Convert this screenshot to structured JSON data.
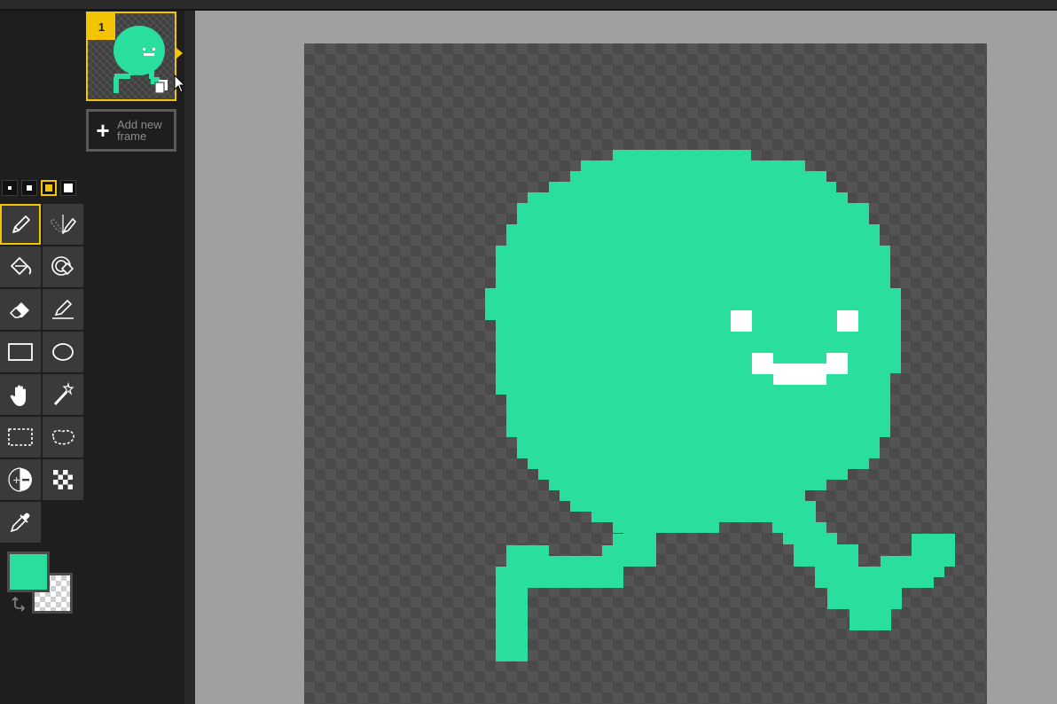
{
  "app": {
    "accent_color": "#f4c400"
  },
  "pen_sizes": [
    {
      "size": 1,
      "active": false
    },
    {
      "size": 2,
      "active": false
    },
    {
      "size": 3,
      "active": true
    },
    {
      "size": 4,
      "active": false
    }
  ],
  "tools": [
    {
      "name": "pen-tool",
      "icon": "pencil-icon",
      "active": true
    },
    {
      "name": "vertical-mirror-tool",
      "icon": "mirror-pen-icon",
      "active": false
    },
    {
      "name": "paint-bucket-tool",
      "icon": "bucket-icon",
      "active": false
    },
    {
      "name": "paint-same-pixels-tool",
      "icon": "target-bucket-icon",
      "active": false
    },
    {
      "name": "eraser-tool",
      "icon": "eraser-icon",
      "active": false
    },
    {
      "name": "stroke-tool",
      "icon": "line-icon",
      "active": false
    },
    {
      "name": "rectangle-tool",
      "icon": "rectangle-icon",
      "active": false
    },
    {
      "name": "circle-tool",
      "icon": "circle-icon",
      "active": false
    },
    {
      "name": "move-tool",
      "icon": "hand-icon",
      "active": false
    },
    {
      "name": "shape-selection-tool",
      "icon": "magic-wand-icon",
      "active": false
    },
    {
      "name": "rectangle-selection-tool",
      "icon": "dashed-rectangle-icon",
      "active": false
    },
    {
      "name": "lasso-selection-tool",
      "icon": "lasso-icon",
      "active": false
    },
    {
      "name": "lighten-darken-tool",
      "icon": "lighten-icon",
      "active": false
    },
    {
      "name": "dithering-tool",
      "icon": "checker-icon",
      "active": false
    },
    {
      "name": "color-picker-tool",
      "icon": "eyedropper-icon",
      "active": false
    }
  ],
  "colors": {
    "primary": "#2ade9e",
    "secondary": "transparent"
  },
  "frames": {
    "items": [
      {
        "number": "1",
        "selected": true
      }
    ],
    "add_label": "Add new frame"
  },
  "drawing": {
    "color": "#2ade9e",
    "face_color": "#ffffff"
  }
}
